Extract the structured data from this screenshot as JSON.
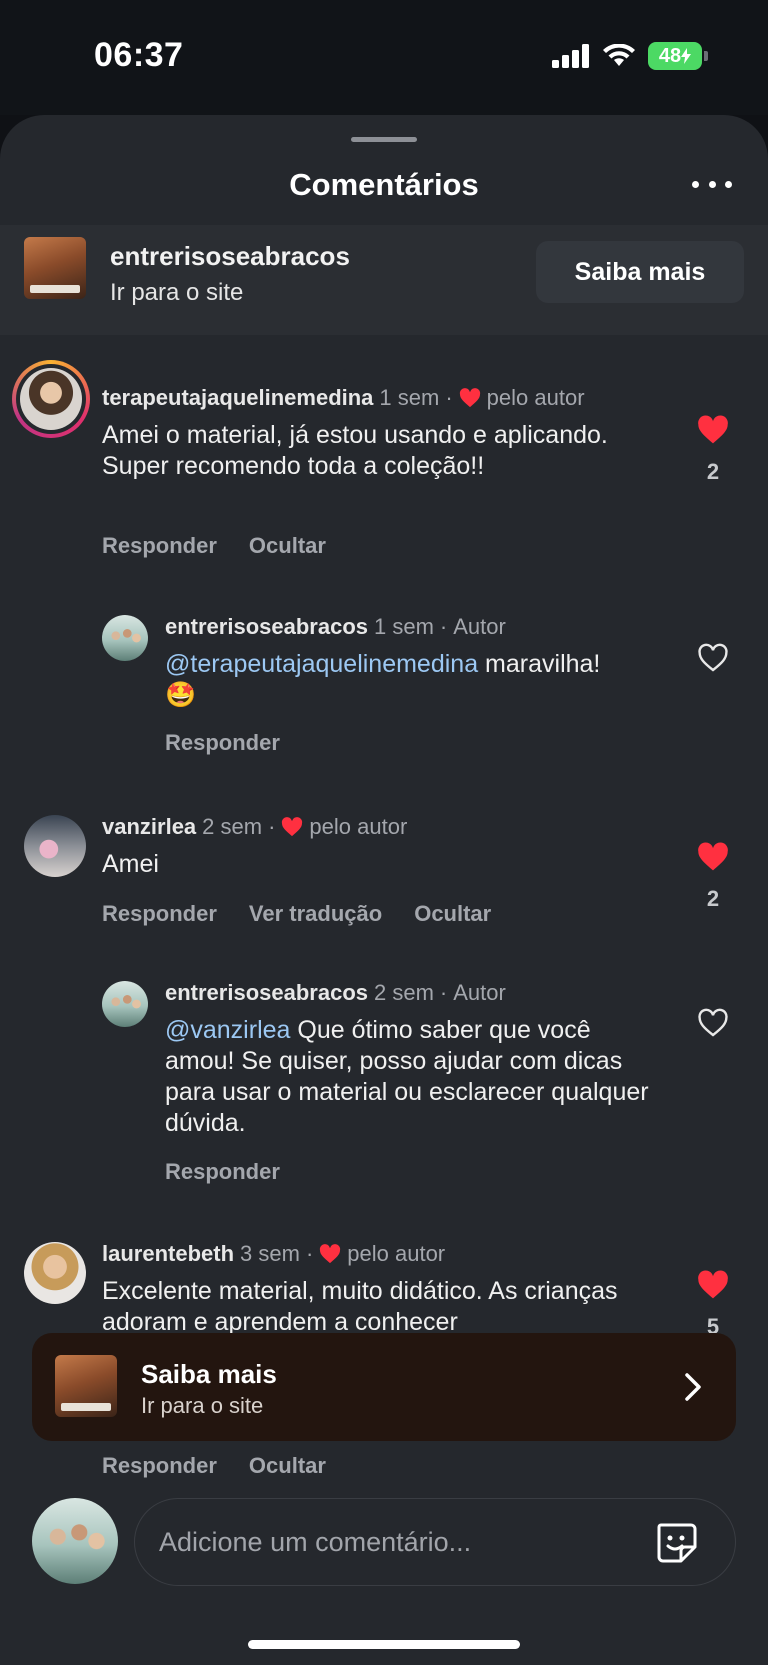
{
  "status_bar": {
    "time": "06:37",
    "battery": "48"
  },
  "sheet": {
    "title": "Comentários"
  },
  "ad_header": {
    "account": "entrerisoseabracos",
    "subtitle": "Ir para o site",
    "button": "Saiba mais"
  },
  "comments": [
    {
      "username": "terapeutajaquelinemedina",
      "time": "1 sem",
      "author_badge": "pelo autor",
      "text": "Amei o material, já estou usando e aplicando. Super recomendo toda a coleção!!",
      "likes": "2",
      "liked": true,
      "actions": [
        "Responder",
        "Ocultar"
      ]
    },
    {
      "username": "entrerisoseabracos",
      "time": "1 sem",
      "role": "Autor",
      "mention": "@terapeutajaquelinemedina",
      "text": " maravilha!",
      "emoji": "🤩",
      "liked": false,
      "actions": [
        "Responder"
      ]
    },
    {
      "username": "vanzirlea",
      "time": "2 sem",
      "author_badge": "pelo autor",
      "text": "Amei",
      "likes": "2",
      "liked": true,
      "actions": [
        "Responder",
        "Ver tradução",
        "Ocultar"
      ]
    },
    {
      "username": "entrerisoseabracos",
      "time": "2 sem",
      "role": "Autor",
      "mention": "@vanzirlea",
      "text": " Que ótimo saber que você amou! Se quiser, posso ajudar com dicas para usar o material ou esclarecer qualquer dúvida.",
      "liked": false,
      "actions": [
        "Responder"
      ]
    },
    {
      "username": "laurentebeth",
      "time": "3 sem",
      "author_badge": "pelo autor",
      "text": "Excelente material, muito didático. As crianças adoram e aprendem a conhecer",
      "likes": "5",
      "liked": true,
      "actions": [
        "Responder",
        "Ocultar"
      ]
    }
  ],
  "banner": {
    "title": "Saiba mais",
    "subtitle": "Ir para o site"
  },
  "input": {
    "placeholder": "Adicione um comentário..."
  },
  "colors": {
    "like_red": "#ff3040",
    "mention": "#9cc8f3",
    "sheet_bg": "#25282d",
    "banner_bg": "#23150f"
  }
}
